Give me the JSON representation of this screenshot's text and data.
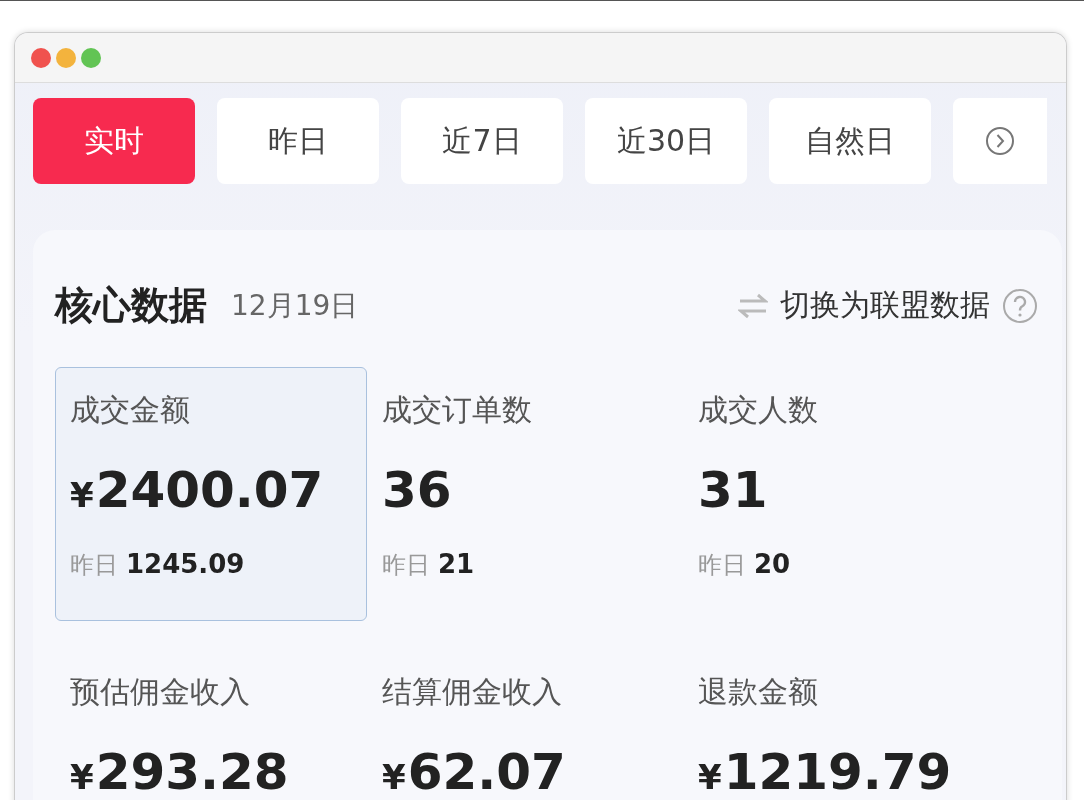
{
  "tabs": [
    {
      "label": "实时",
      "selected": true
    },
    {
      "label": "昨日",
      "selected": false
    },
    {
      "label": "近7日",
      "selected": false
    },
    {
      "label": "近30日",
      "selected": false
    },
    {
      "label": "自然日",
      "selected": false
    }
  ],
  "core": {
    "title": "核心数据",
    "date": "12月19日",
    "switch_label": "切换为联盟数据",
    "metrics": [
      {
        "label": "成交金额",
        "currency": "¥",
        "amount": "2400.07",
        "prev_label": "昨日",
        "prev_value": "1245.09",
        "selected": true
      },
      {
        "label": "成交订单数",
        "amount": "36",
        "prev_label": "昨日",
        "prev_value": "21",
        "selected": false
      },
      {
        "label": "成交人数",
        "amount": "31",
        "prev_label": "昨日",
        "prev_value": "20",
        "selected": false
      },
      {
        "label": "预估佣金收入",
        "currency": "¥",
        "amount": "293.28",
        "selected": false
      },
      {
        "label": "结算佣金收入",
        "currency": "¥",
        "amount": "62.07",
        "selected": false
      },
      {
        "label": "退款金额",
        "currency": "¥",
        "amount": "1219.79",
        "selected": false
      }
    ]
  }
}
